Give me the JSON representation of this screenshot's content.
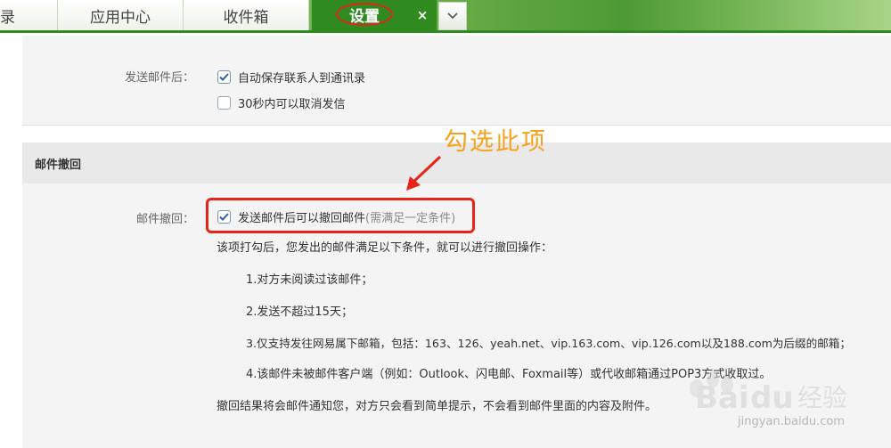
{
  "tabs": {
    "partial_label": "录",
    "app_center": "应用中心",
    "inbox": "收件箱",
    "settings": "设置",
    "close_glyph": "×"
  },
  "after_send": {
    "label": "发送邮件后：",
    "options": [
      {
        "text": "自动保存联系人到通讯录",
        "checked": true
      },
      {
        "text": "30秒内可以取消发信",
        "checked": false
      }
    ]
  },
  "recall_section": {
    "title": "邮件撤回",
    "label": "邮件撤回：",
    "option": {
      "text": "发送邮件后可以撤回邮件",
      "hint": "(需满足一定条件)",
      "checked": true
    },
    "intro": "该项打勾后，您发出的邮件满足以下条件，就可以进行撤回操作：",
    "conditions": [
      "1.对方未阅读过该邮件；",
      "2.发送不超过15天；",
      "3.仅支持发往网易属下邮箱，包括：163、126、yeah.net、vip.163.com、vip.126.com以及188.com为后缀的邮箱；",
      "4.该邮件未被邮件客户端（例如：Outlook、闪电邮、Foxmail等）或代收邮箱通过POP3方式收取过。"
    ],
    "result": "撤回结果将会邮件通知您，对方只会看到简单提示，不会看到邮件里面的内容及附件。"
  },
  "annotation": "勾选此项",
  "watermark": {
    "logo": "Baidu经验",
    "url": "jingyan.baidu.com"
  },
  "colors": {
    "tab_active": "#2f8a1f",
    "highlight": "#e8231a",
    "annotation": "#f7a21c"
  }
}
